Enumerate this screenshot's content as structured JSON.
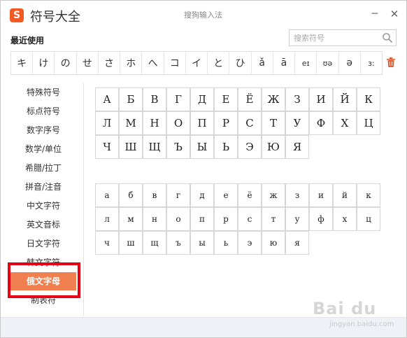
{
  "window": {
    "logo_letter": "S",
    "title": "符号大全",
    "ime_name": "搜狗输入法",
    "minimize": "─",
    "close": "✕"
  },
  "recent": {
    "label": "最近使用",
    "symbols": [
      "キ",
      "け",
      "の",
      "せ",
      "さ",
      "ホ",
      "へ",
      "コ",
      "イ",
      "と",
      "ひ",
      "ǎ",
      "ā",
      "eɪ",
      "ʊə",
      "ə",
      "ɜ:"
    ]
  },
  "search": {
    "placeholder": "搜索符号"
  },
  "sidebar": {
    "items": [
      {
        "label": "特殊符号"
      },
      {
        "label": "标点符号"
      },
      {
        "label": "数字序号"
      },
      {
        "label": "数学/单位"
      },
      {
        "label": "希腊/拉丁"
      },
      {
        "label": "拼音/注音"
      },
      {
        "label": "中文字符"
      },
      {
        "label": "英文音标"
      },
      {
        "label": "日文字符"
      },
      {
        "label": "韩文字符"
      },
      {
        "label": "俄文字母"
      },
      {
        "label": "制表符"
      }
    ],
    "active_index": 10
  },
  "uppercase": [
    "А",
    "Б",
    "В",
    "Г",
    "Д",
    "Е",
    "Ё",
    "Ж",
    "З",
    "И",
    "Й",
    "К",
    "Л",
    "М",
    "Н",
    "О",
    "П",
    "Р",
    "С",
    "Т",
    "У",
    "Ф",
    "Х",
    "Ц",
    "Ч",
    "Ш",
    "Щ",
    "Ъ",
    "Ы",
    "Ь",
    "Э",
    "Ю",
    "Я"
  ],
  "lowercase": [
    "а",
    "б",
    "в",
    "г",
    "д",
    "е",
    "ё",
    "ж",
    "з",
    "и",
    "й",
    "к",
    "л",
    "м",
    "н",
    "о",
    "п",
    "р",
    "с",
    "т",
    "у",
    "ф",
    "х",
    "ц",
    "ч",
    "ш",
    "щ",
    "ъ",
    "ы",
    "ь",
    "э",
    "ю",
    "я"
  ],
  "watermark": {
    "text": "Bai du",
    "sub": "jingyan.baidu.com"
  },
  "colors": {
    "accent": "#f0804f",
    "highlight": "#e60012",
    "logo": "#f15a22"
  }
}
